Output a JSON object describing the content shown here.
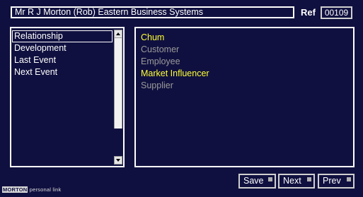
{
  "header": {
    "contact_title": "Mr R J Morton (Rob)  Eastern Business Systems",
    "ref_label": "Ref",
    "ref_value": "00109"
  },
  "category_list": {
    "items": [
      {
        "label": "Relationship",
        "selected": true
      },
      {
        "label": "Development",
        "selected": false
      },
      {
        "label": "Last Event",
        "selected": false
      },
      {
        "label": "Next Event",
        "selected": false
      }
    ]
  },
  "options": [
    {
      "label": "Chum",
      "active": true
    },
    {
      "label": "Customer",
      "active": false
    },
    {
      "label": "Employee",
      "active": false
    },
    {
      "label": "Market Influencer",
      "active": true
    },
    {
      "label": "Supplier",
      "active": false
    }
  ],
  "colors": {
    "background": "#101040",
    "active_option": "#ffff33",
    "inactive_option": "#9a9a9a",
    "text": "#ffffff"
  },
  "buttons": {
    "save": "Save",
    "next": "Next",
    "prev": "Prev"
  },
  "footer": {
    "brand": "MORTON",
    "product": "personal link"
  }
}
